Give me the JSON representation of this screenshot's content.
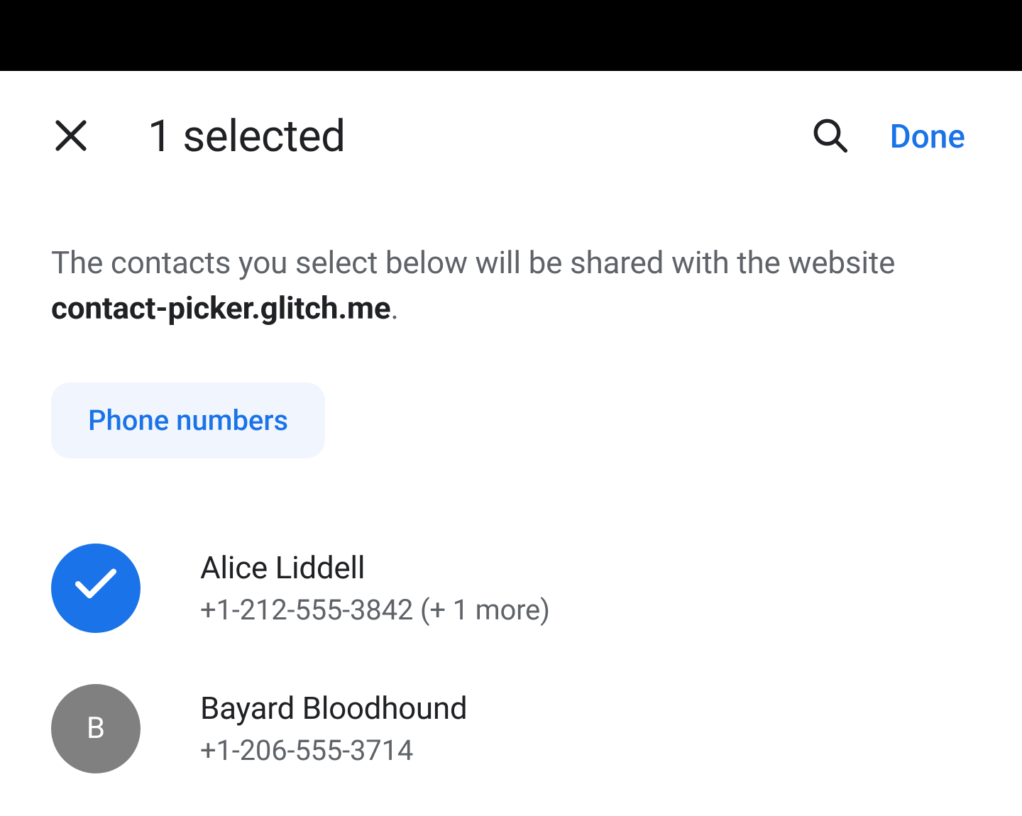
{
  "header": {
    "title": "1 selected",
    "done_label": "Done"
  },
  "description": {
    "prefix": "The contacts you select below will be shared with the website ",
    "website": "contact-picker.glitch.me",
    "suffix": "."
  },
  "filter_chip": "Phone numbers",
  "contacts": [
    {
      "selected": true,
      "initial": "",
      "name": "Alice Liddell",
      "phone": "+1-212-555-3842 (+ 1 more)"
    },
    {
      "selected": false,
      "initial": "B",
      "name": "Bayard Bloodhound",
      "phone": "+1-206-555-3714"
    }
  ]
}
